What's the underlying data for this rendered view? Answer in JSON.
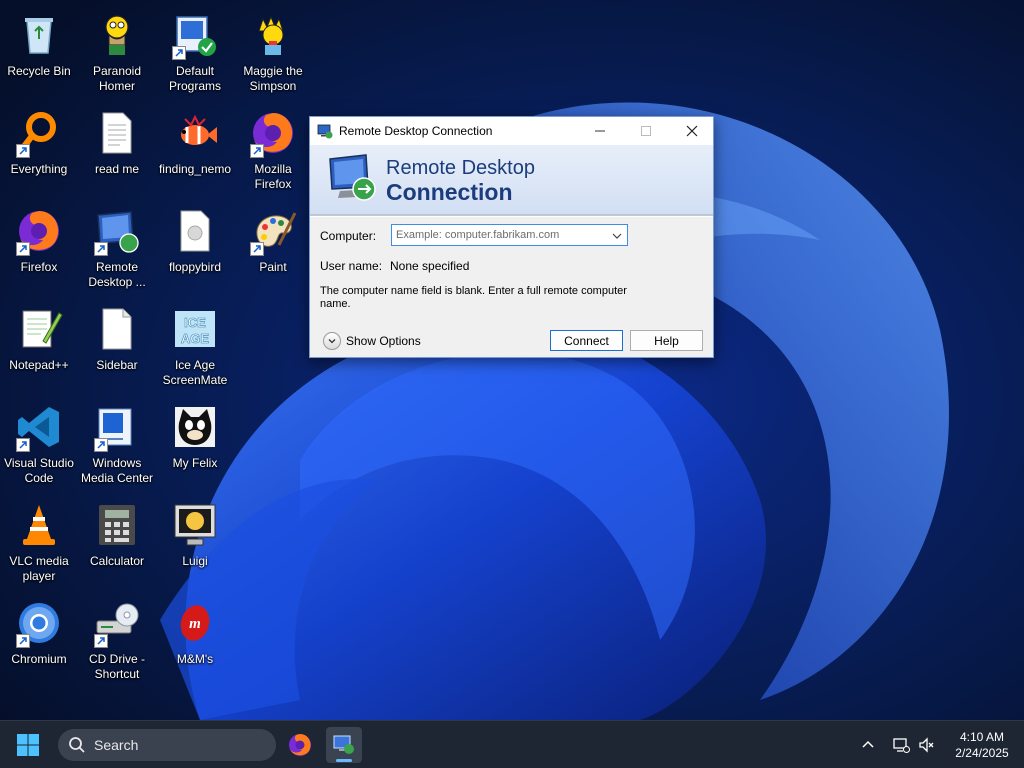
{
  "desktop": {
    "icons": [
      {
        "label": "Recycle Bin",
        "icon": "recycle-bin-icon"
      },
      {
        "label": "Paranoid\nHomer",
        "icon": "homer-icon"
      },
      {
        "label": "Default\nPrograms",
        "icon": "default-programs-icon"
      },
      {
        "label": "Maggie the\nSimpson",
        "icon": "maggie-icon"
      },
      {
        "label": "Everything",
        "icon": "everything-search-icon"
      },
      {
        "label": "read me",
        "icon": "text-file-icon"
      },
      {
        "label": "finding_nemo",
        "icon": "nemo-fish-icon"
      },
      {
        "label": "Mozilla\nFirefox",
        "icon": "firefox-icon"
      },
      {
        "label": "Firefox",
        "icon": "firefox-icon"
      },
      {
        "label": "Remote\nDesktop ...",
        "icon": "remote-desktop-icon"
      },
      {
        "label": "floppybird",
        "icon": "file-icon"
      },
      {
        "label": "Paint",
        "icon": "paint-palette-icon"
      },
      {
        "label": "Notepad++",
        "icon": "notepad-plus-plus-icon"
      },
      {
        "label": "Sidebar",
        "icon": "blank-file-icon"
      },
      {
        "label": "Ice Age\nScreenMate",
        "icon": "ice-age-icon"
      },
      {
        "label": "Visual Studio\nCode",
        "icon": "vscode-icon"
      },
      {
        "label": "Windows\nMedia Center",
        "icon": "windows-media-center-icon"
      },
      {
        "label": "My Felix",
        "icon": "felix-cat-icon"
      },
      {
        "label": "VLC media\nplayer",
        "icon": "vlc-cone-icon"
      },
      {
        "label": "Calculator",
        "icon": "calculator-icon"
      },
      {
        "label": "Luigi",
        "icon": "luigi-monitor-icon"
      },
      {
        "label": "Chromium",
        "icon": "chromium-icon"
      },
      {
        "label": "CD Drive -\nShortcut",
        "icon": "cd-drive-icon"
      },
      {
        "label": "M&M's",
        "icon": "mms-candy-icon"
      }
    ]
  },
  "dialog": {
    "title": "Remote Desktop Connection",
    "banner_line1": "Remote Desktop",
    "banner_line2": "Connection",
    "computer_label": "Computer:",
    "computer_placeholder": "Example: computer.fabrikam.com",
    "computer_value": "",
    "username_label": "User name:",
    "username_value": "None specified",
    "message": "The computer name field is blank. Enter a full remote computer name.",
    "show_options": "Show Options",
    "connect": "Connect",
    "help": "Help"
  },
  "taskbar": {
    "search_placeholder": "Search",
    "time": "4:10 AM",
    "date": "2/24/2025"
  },
  "colors": {
    "accent": "#1b3d7d",
    "taskbar": "#1e2633",
    "focus_border": "#3d8ee3"
  }
}
